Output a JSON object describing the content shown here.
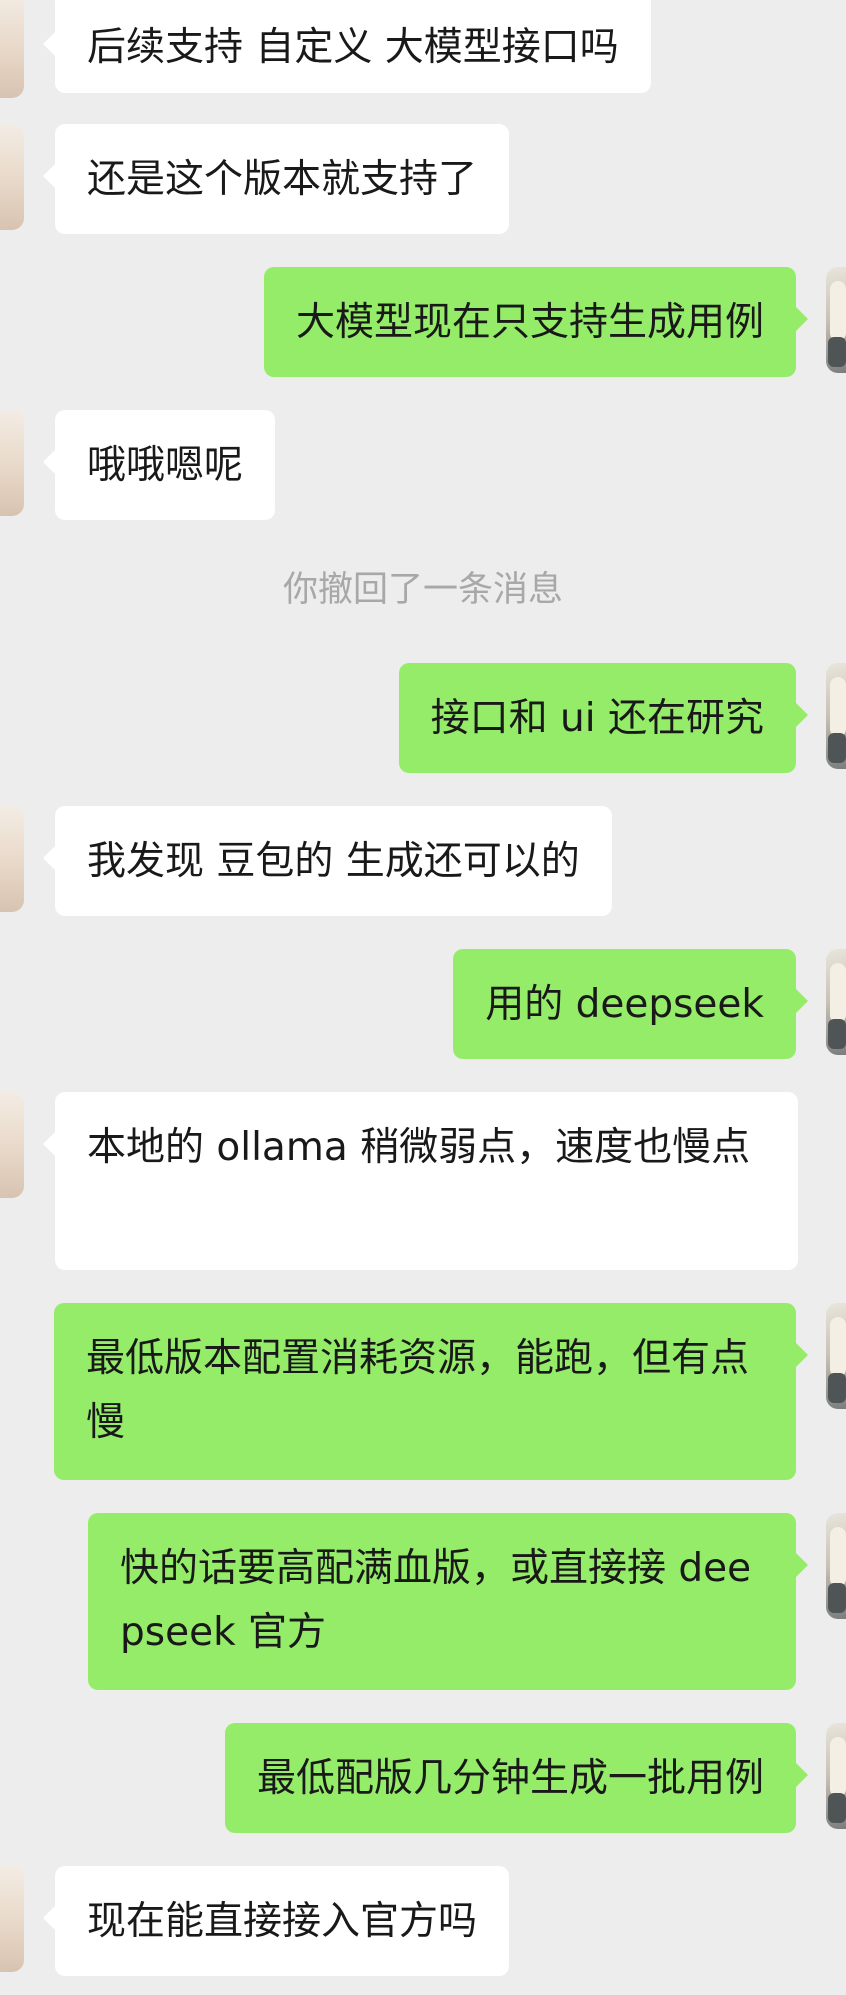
{
  "chat": {
    "messages": [
      {
        "side": "in",
        "text": "后续支持 自定义 大模型接口吗"
      },
      {
        "side": "in",
        "text": "还是这个版本就支持了"
      },
      {
        "side": "out",
        "text": "大模型现在只支持生成用例"
      },
      {
        "side": "in",
        "text": "哦哦嗯呢"
      },
      {
        "type": "system",
        "text": "你撤回了一条消息"
      },
      {
        "side": "out",
        "text": "接口和 ui 还在研究"
      },
      {
        "side": "in",
        "text": "我发现 豆包的 生成还可以的"
      },
      {
        "side": "out",
        "text": "用的 deepseek"
      },
      {
        "side": "in",
        "text": "本地的 ollama 稍微弱点，速度也慢点"
      },
      {
        "side": "out",
        "text": "最低版本配置消耗资源，能跑，但有点慢"
      },
      {
        "side": "out",
        "text": "快的话要高配满血版，或直接接 deepseek 官方"
      },
      {
        "side": "out",
        "text": "最低配版几分钟生成一批用例"
      },
      {
        "side": "in",
        "text": "现在能直接接入官方吗"
      }
    ]
  }
}
